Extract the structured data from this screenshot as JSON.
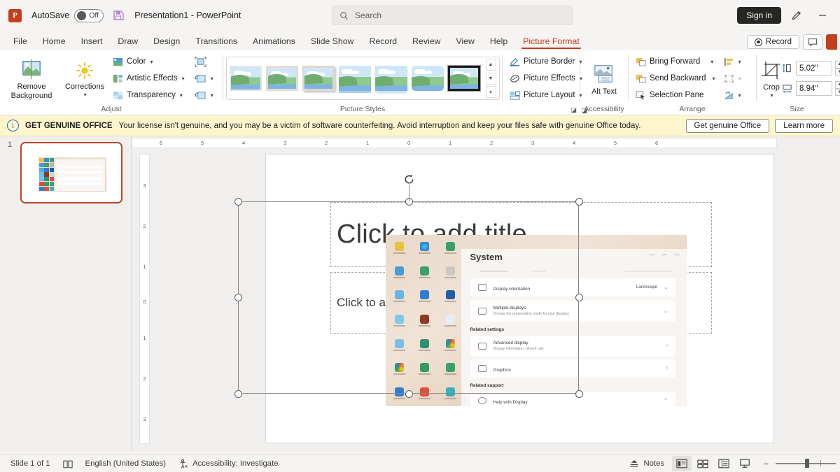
{
  "titlebar": {
    "app_icon": "powerpoint-logo",
    "autosave_label": "AutoSave",
    "autosave_state": "Off",
    "save_icon": "save-icon",
    "document_title": "Presentation1  -  PowerPoint",
    "search_placeholder": "Search",
    "search_icon": "search-icon",
    "sign_in": "Sign in",
    "pen_icon": "pen-icon",
    "minimize_icon": "minimize-icon"
  },
  "tabs": [
    {
      "label": "File",
      "active": false
    },
    {
      "label": "Home",
      "active": false
    },
    {
      "label": "Insert",
      "active": false
    },
    {
      "label": "Draw",
      "active": false
    },
    {
      "label": "Design",
      "active": false
    },
    {
      "label": "Transitions",
      "active": false
    },
    {
      "label": "Animations",
      "active": false
    },
    {
      "label": "Slide Show",
      "active": false
    },
    {
      "label": "Record",
      "active": false
    },
    {
      "label": "Review",
      "active": false
    },
    {
      "label": "View",
      "active": false
    },
    {
      "label": "Help",
      "active": false
    },
    {
      "label": "Picture Format",
      "active": true
    }
  ],
  "tabstrip_right": {
    "record_label": "Record",
    "comment_icon": "comment-icon",
    "share_icon": "share-button"
  },
  "ribbon": {
    "adjust": {
      "group_label": "Adjust",
      "remove_background": "Remove Background",
      "corrections": "Corrections",
      "color": "Color",
      "artistic_effects": "Artistic Effects",
      "transparency": "Transparency",
      "compress_pictures_icon": "compress-pictures-icon",
      "change_picture_icon": "change-picture-icon",
      "reset_picture_icon": "reset-picture-icon"
    },
    "picture_styles": {
      "group_label": "Picture Styles",
      "items": [
        {
          "name": "simple-frame-white"
        },
        {
          "name": "beveled-matte-white"
        },
        {
          "name": "drop-shadow-rectangle"
        },
        {
          "name": "reflected-rounded-rectangle"
        },
        {
          "name": "soft-edge-rectangle"
        },
        {
          "name": "rounded-diagonal-corner"
        },
        {
          "name": "metal-frame"
        }
      ],
      "selected_index": 6,
      "scroll_up_icon": "chevron-up-icon",
      "scroll_down_icon": "chevron-down-icon",
      "more_icon": "gallery-more-icon"
    },
    "picture_tools": {
      "picture_border": "Picture Border",
      "picture_effects": "Picture Effects",
      "picture_layout": "Picture Layout"
    },
    "accessibility": {
      "group_label": "Accessibility",
      "alt_text": "Alt Text",
      "dialog_launcher": "dialog-launcher-icon"
    },
    "arrange": {
      "group_label": "Arrange",
      "bring_forward": "Bring Forward",
      "send_backward": "Send Backward",
      "selection_pane": "Selection Pane",
      "align_icon": "align-objects-icon",
      "group_icon": "group-objects-icon",
      "rotate_icon": "rotate-objects-icon"
    },
    "size": {
      "group_label": "Size",
      "crop_label": "Crop",
      "height_icon": "shape-height-icon",
      "height_value": "5.02\"",
      "width_icon": "shape-width-icon",
      "width_value": "8.94\"",
      "dialog_launcher": "dialog-launcher-icon"
    }
  },
  "notification": {
    "icon": "info-icon",
    "headline": "GET GENUINE OFFICE",
    "message": "Your license isn't genuine, and you may be a victim of software counterfeiting. Avoid interruption and keep your files safe with genuine Office today.",
    "primary_button": "Get genuine Office",
    "secondary_button": "Learn more"
  },
  "thumbnail_pane": {
    "slide_number": "1"
  },
  "rulers": {
    "horizontal": [
      "6",
      "5",
      "4",
      "3",
      "2",
      "1",
      "0",
      "1",
      "2",
      "3",
      "4",
      "5",
      "6"
    ],
    "vertical": [
      "3",
      "2",
      "1",
      "0",
      "1",
      "2",
      "3"
    ]
  },
  "slide": {
    "title_placeholder": "Click to add title",
    "subtitle_placeholder": "Click to add subtitle",
    "picture": {
      "name": "inserted-screenshot",
      "panel_title": "System",
      "rows": [
        {
          "title": "Display orientation",
          "sub": "",
          "value": "Landscape",
          "chev": "⌄",
          "icon": "orientation-icon"
        },
        {
          "title": "Multiple displays",
          "sub": "Choose the presentation mode for your displays",
          "value": "",
          "chev": "⌄",
          "icon": "multiple-displays-icon"
        }
      ],
      "section_related_settings": "Related settings",
      "related_rows": [
        {
          "title": "Advanced display",
          "sub": "Display information, refresh rate",
          "chev": "›",
          "icon": "monitor-icon"
        },
        {
          "title": "Graphics",
          "sub": "",
          "chev": "›",
          "icon": "graphics-icon"
        }
      ],
      "section_related_support": "Related support",
      "support_rows": [
        {
          "title": "Help with Display",
          "sub": "",
          "chev": "⌃",
          "icon": "help-icon"
        }
      ]
    },
    "selection": {
      "rotate_handle": "rotate-handle",
      "handles": 8
    }
  },
  "statusbar": {
    "slide_count": "Slide 1 of 1",
    "notes_icon": "notes-page-icon",
    "language": "English (United States)",
    "language_icon": "spell-check-icon",
    "accessibility": "Accessibility: Investigate",
    "accessibility_icon": "accessibility-icon",
    "notes_label": "Notes",
    "views": [
      {
        "name": "normal-view",
        "active": true
      },
      {
        "name": "slide-sorter-view",
        "active": false
      },
      {
        "name": "reading-view",
        "active": false
      },
      {
        "name": "slide-show-view",
        "active": false
      }
    ],
    "zoom_out": "−",
    "zoom_in": "+"
  },
  "colors": {
    "accent": "#c43e1c",
    "notification_bg": "#fdf6cd",
    "selection_border": "#b7472a"
  }
}
